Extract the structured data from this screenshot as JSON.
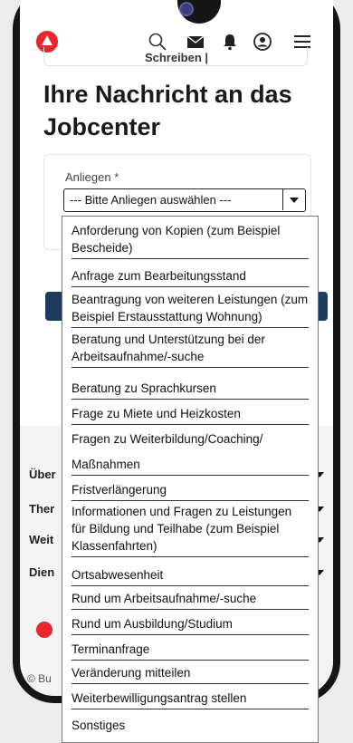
{
  "header": {
    "breadcrumb": "Schreiben |",
    "icons": [
      "logo-icon",
      "search-icon",
      "mail-icon",
      "bell-icon",
      "user-icon",
      "menu-icon"
    ]
  },
  "page": {
    "title": "Ihre Nachricht an das Jobcenter"
  },
  "form": {
    "field_label": "Anliegen *",
    "select_value": "--- Bitte Anliegen auswählen ---"
  },
  "dropdown": {
    "options": [
      "Anforderung von Kopien (zum Beispiel Bescheide)",
      "Anfrage zum Bearbeitungsstand",
      "Beantragung von weiteren Leistungen (zum Beispiel Erstausstattung Wohnung)",
      "Beratung und Unterstützung bei der  Arbeitsaufnahme/-suche",
      "Beratung zu Sprachkursen",
      "Frage zu Miete und Heizkosten",
      "Fragen zu Weiterbildung/Coaching/",
      "Maßnahmen",
      "Fristverlängerung",
      "Informationen  und Fragen zu Leistungen für Bildung und Teilhabe (zum Beispiel Klassenfahrten)",
      "Ortsabwesenheit",
      "Rund um Arbeitsaufnahme/-suche",
      "Rund um Ausbildung/Studium",
      "Terminanfrage",
      "Veränderung mitteilen",
      "Weiterbewilligungsantrag  stellen",
      "Sonstiges"
    ]
  },
  "footer": {
    "rows": [
      "Über",
      "Ther",
      "Weit",
      "Dien"
    ],
    "copyright": "© Bu"
  },
  "colors": {
    "brand_red": "#e8262b",
    "button_navy": "#1f3a5f"
  }
}
